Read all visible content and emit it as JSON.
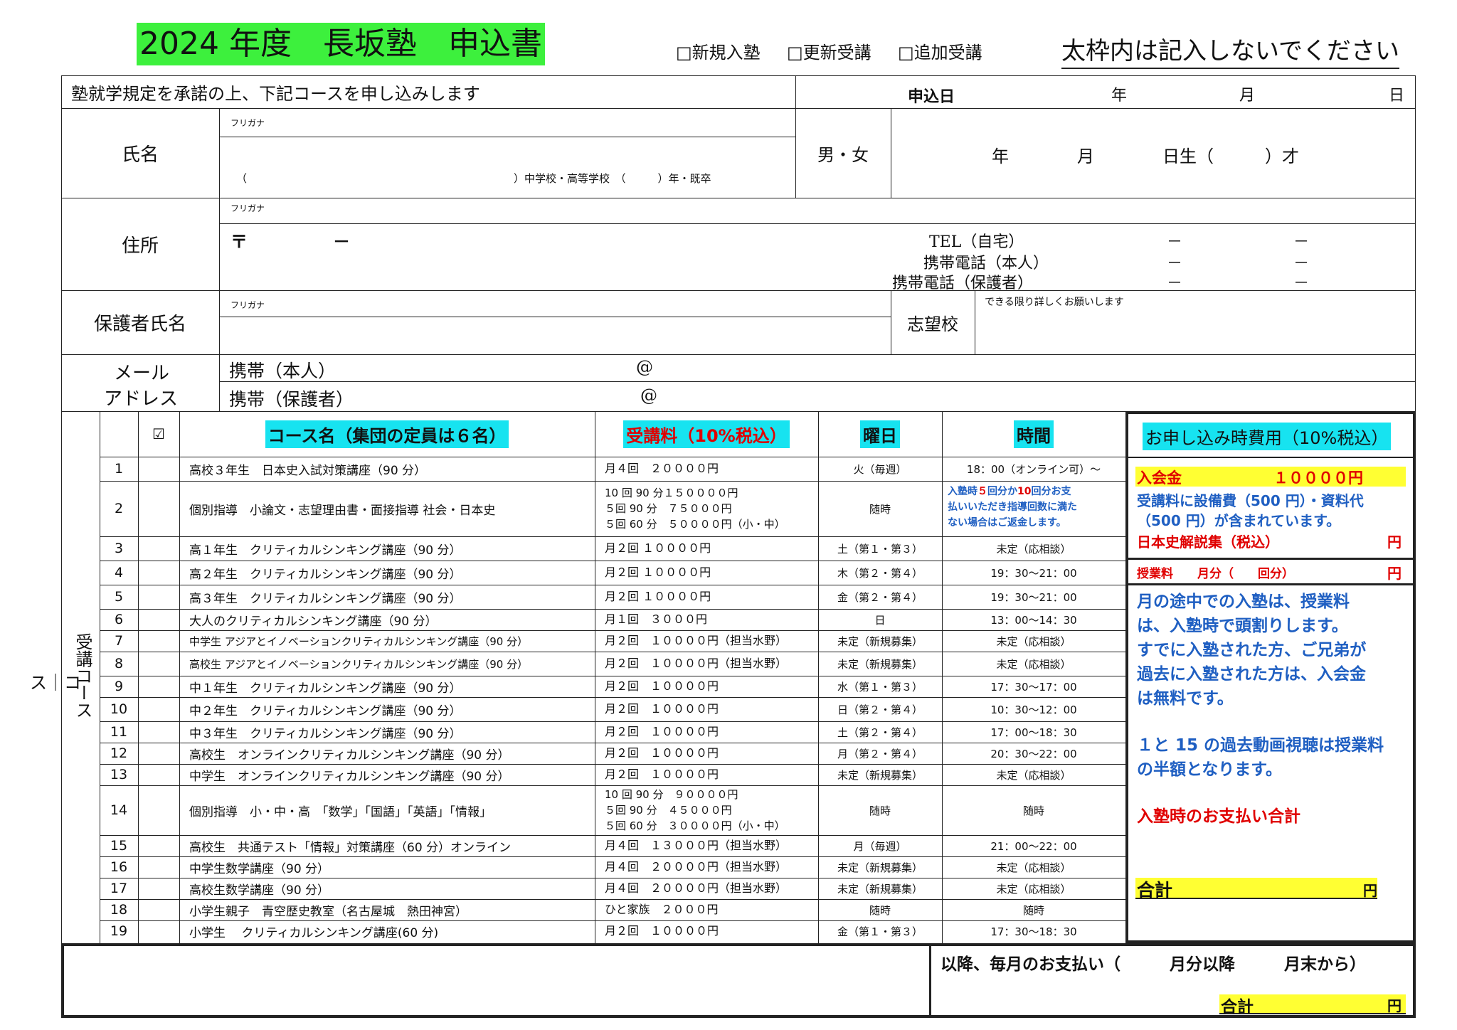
{
  "header": {
    "title": "2024 年度　長坂塾　申込書",
    "checks": [
      "□新規入塾",
      "□更新受講",
      "□追加受講"
    ],
    "notice": "太枠内は記入しないでください"
  },
  "form": {
    "agree_text": "塾就学規定を承諾の上、下記コースを申し込みします",
    "apply_date_label": "申込日",
    "year": "年",
    "month": "月",
    "day": "日",
    "furigana": "フリガナ",
    "name_label": "氏名",
    "school_line": "（　　　　　　　　　　　　　　　　　　　　　　　　　）中学校・高等学校　（　　　）年・既卒",
    "gender": "男・女",
    "birth": "年　　　　月　　　　日生（　　　）才",
    "address_label": "住所",
    "postal": "〒　　　　　－",
    "tel_home": "TEL（自宅）",
    "tel_self": "携帯電話（本人）",
    "tel_parent": "携帯電話（保護者）",
    "dash": "－",
    "guardian_label": "保護者氏名",
    "school_wish_label": "志望校",
    "school_wish_note": "できる限り詳しくお願いします",
    "mail_label_1": "メール",
    "mail_label_2": "アドレス",
    "mail_self": "携帯（本人）",
    "mail_parent": "携帯（保護者）",
    "at": "@",
    "vertical_label": "受講コース"
  },
  "courses": {
    "headers": {
      "check": "☑",
      "name": "コース名（集団の定員は６名）",
      "fee": "受講料（10%税込）",
      "day": "曜日",
      "time": "時間"
    },
    "rows": [
      {
        "no": "1",
        "name": "高校３年生　日本史入試対策講座（90 分）",
        "fee": [
          "月４回　２００００円"
        ],
        "day": "火（毎週）",
        "time": "18：00（オンライン可）～"
      },
      {
        "no": "2",
        "name": "個別指導　小論文・志望理由書・面接指導 社会・日本史",
        "fee": [
          "10 回 90 分１５００００円",
          "５回 90 分　７５０００円",
          "５回 60 分　５００００円（小・中）"
        ],
        "day": "随時",
        "time": ""
      },
      {
        "no": "3",
        "name": "高１年生　クリティカルシンキング講座（90 分）",
        "fee": [
          "月２回 １００００円"
        ],
        "day": "土（第１・第３）",
        "time": "未定（応相談）"
      },
      {
        "no": "4",
        "name": "高２年生　クリティカルシンキング講座（90 分）",
        "fee": [
          "月２回 １００００円"
        ],
        "day": "木（第２・第４）",
        "time": "19：30～21：00"
      },
      {
        "no": "5",
        "name": "高３年生　クリティカルシンキング講座（90 分）",
        "fee": [
          "月２回 １００００円"
        ],
        "day": "金（第２・第４）",
        "time": "19：30～21：00"
      },
      {
        "no": "6",
        "name": "大人のクリティカルシンキング講座（90 分）",
        "fee": [
          "月１回　３０００円"
        ],
        "day": "日",
        "time": "13：00～14：30"
      },
      {
        "no": "7",
        "name": "中学生 アジアとイノベーションクリティカルシンキング講座（90 分）",
        "fee": [
          "月２回　１００００円（担当水野）"
        ],
        "day": "未定（新規募集）",
        "time": "未定（応相談）"
      },
      {
        "no": "8",
        "name": "高校生 アジアとイノベーションクリティカルシンキング講座（90 分）",
        "fee": [
          "月２回　１００００円（担当水野）"
        ],
        "day": "未定（新規募集）",
        "time": "未定（応相談）"
      },
      {
        "no": "9",
        "name": "中１年生　クリティカルシンキング講座（90 分）",
        "fee": [
          "月２回　１００００円"
        ],
        "day": "水（第１・第３）",
        "time": "17：30～17：00"
      },
      {
        "no": "10",
        "name": "中２年生　クリティカルシンキング講座（90 分）",
        "fee": [
          "月２回　１００００円"
        ],
        "day": "日（第２・第４）",
        "time": "10：30～12：00"
      },
      {
        "no": "11",
        "name": "中３年生　クリティカルシンキング講座（90 分）",
        "fee": [
          "月２回　１００００円"
        ],
        "day": "土（第２・第４）",
        "time": "17：00～18：30"
      },
      {
        "no": "12",
        "name": "高校生　オンラインクリティカルシンキング講座（90 分）",
        "fee": [
          "月２回　１００００円"
        ],
        "day": "月（第２・第４）",
        "time": "20：30～22：00"
      },
      {
        "no": "13",
        "name": "中学生　オンラインクリティカルシンキング講座（90 分）",
        "fee": [
          "月２回　１００００円"
        ],
        "day": "未定（新規募集）",
        "time": "未定（応相談）"
      },
      {
        "no": "14",
        "name": "個別指導　小・中・高　「数学」「国語」「英語」「情報」",
        "fee": [
          "10 回 90 分　９００００円",
          "５回 90 分　４５０００円",
          "５回 60 分　３００００円（小・中）"
        ],
        "day": "随時",
        "time": "随時"
      },
      {
        "no": "15",
        "name": "高校生　共通テスト「情報」対策講座（60 分）オンライン",
        "fee": [
          "月４回　１３０００円（担当水野）"
        ],
        "day": "月（毎週）",
        "time": "21：00～22：00"
      },
      {
        "no": "16",
        "name": "中学生数学講座（90 分）",
        "fee": [
          "月４回　２００００円（担当水野）"
        ],
        "day": "未定（新規募集）",
        "time": "未定（応相談）"
      },
      {
        "no": "17",
        "name": "高校生数学講座（90 分）",
        "fee": [
          "月４回　２００００円（担当水野）"
        ],
        "day": "未定（新規募集）",
        "time": "未定（応相談）"
      },
      {
        "no": "18",
        "name": "小学生親子　青空歴史教室（名古屋城　熱田神宮）",
        "fee": [
          "ひと家族　２０００円"
        ],
        "day": "随時",
        "time": "随時"
      },
      {
        "no": "19",
        "name": "小学生　 クリティカルシンキング講座(60 分)",
        "fee": [
          "月２回　１００００円"
        ],
        "day": "金（第１・第３）",
        "time": "17：30～18：30"
      }
    ],
    "row2_time_note": [
      "入塾時",
      "５",
      "回分か",
      "10",
      "回分お支",
      "払いいただき指導回数に満た",
      "ない場合はご返金します。"
    ]
  },
  "fees_box": {
    "title": "お申し込み時費用（10%税込）",
    "admission_label": "入会金",
    "admission_value": "１００００円",
    "includes_note_1": "受講料に設備費（500 円）・資料代",
    "includes_note_2": "（500 円）が含まれています。",
    "history_book": "日本史解説集（税込）",
    "yen": "円",
    "tuition_line": "授業料　　月分（　　回分）",
    "info_1": "月の途中での入塾は、授業料",
    "info_2": "は、入塾時で頭割りします。",
    "info_3": "すでに入塾された方、ご兄弟が",
    "info_4": "過去に入塾された方は、入会金",
    "info_5": "は無料です。",
    "info_6": "１と 15 の過去動画視聴は授業料",
    "info_7": "の半額となります。",
    "payment_total_label": "入塾時のお支払い合計",
    "total_label": "合計",
    "monthly_line": "以降、毎月のお支払い（　　　月分以降　　　月末から）"
  }
}
